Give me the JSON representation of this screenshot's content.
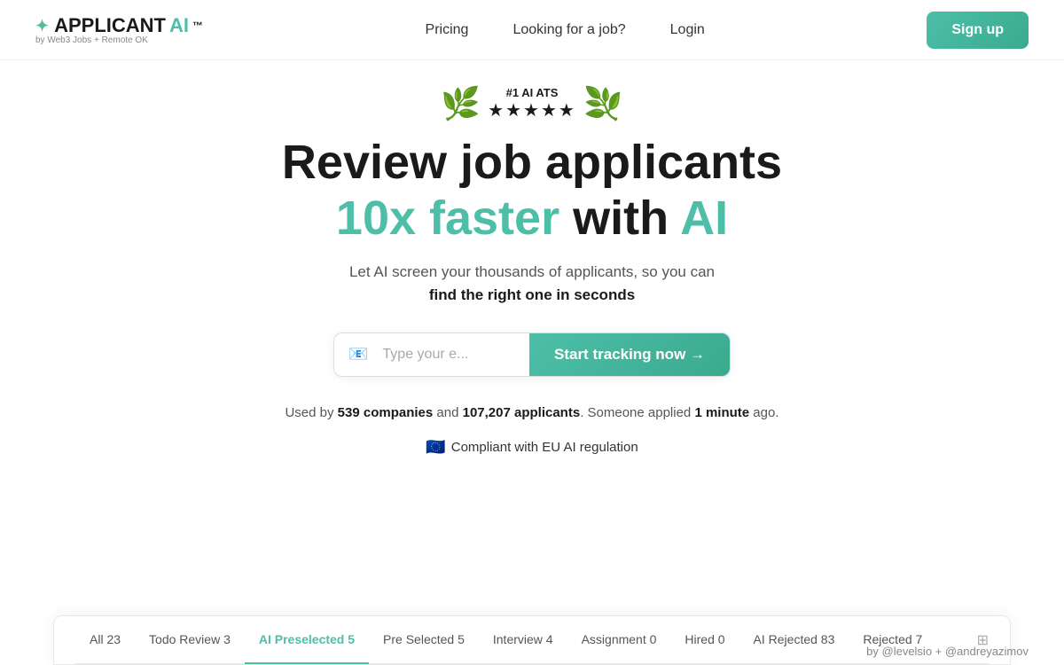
{
  "brand": {
    "name": "APPLICANT",
    "ai": "AI",
    "tm": "™",
    "sub": "by Web3 Jobs + Remote OK",
    "icon": "✦"
  },
  "nav": {
    "links": [
      "Pricing",
      "Looking for a job?",
      "Login"
    ],
    "signup": "Sign up"
  },
  "badge": {
    "label": "#1 AI ATS",
    "stars": "★★★★★"
  },
  "hero": {
    "line1": "Review job applicants",
    "line2_green": "10x faster",
    "line2_mid": " with ",
    "line2_ai": "AI",
    "sub1": "Let AI screen your thousands of applicants, so you can",
    "sub2": "find the right one in seconds",
    "email_placeholder": "Type your e...",
    "email_emoji": "📧",
    "cta_btn": "Start tracking now →",
    "social1": "Used by ",
    "companies": "539 companies",
    "and": " and ",
    "applicants": "107,207 applicants",
    "social2": ". Someone applied ",
    "time": "1 minute",
    "ago": " ago.",
    "eu_flag": "🇪🇺",
    "eu_text": "Compliant with EU AI regulation"
  },
  "tabs": [
    {
      "label": "All 23",
      "active": false
    },
    {
      "label": "Todo Review 3",
      "active": false
    },
    {
      "label": "AI Preselected 5",
      "active": true
    },
    {
      "label": "Pre Selected 5",
      "active": false
    },
    {
      "label": "Interview 4",
      "active": false
    },
    {
      "label": "Assignment 0",
      "active": false
    },
    {
      "label": "Hired 0",
      "active": false
    },
    {
      "label": "AI Rejected 83",
      "active": false
    },
    {
      "label": "Rejected 7",
      "active": false
    }
  ],
  "attribution": "by @levelsio + @andreyazimov"
}
